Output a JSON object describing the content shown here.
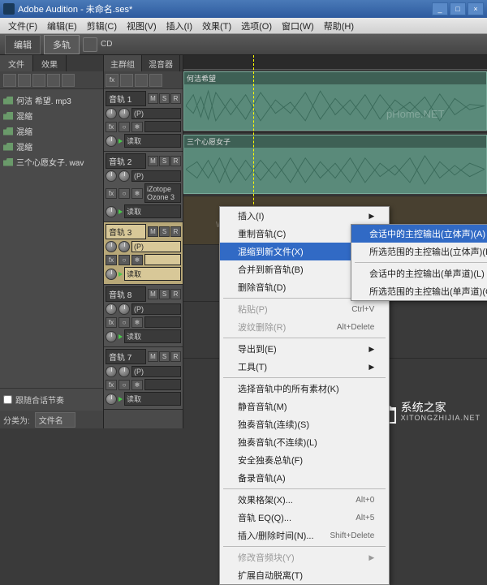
{
  "title": "Adobe Audition - 未命名.ses*",
  "menubar": [
    "文件(F)",
    "编辑(E)",
    "剪辑(C)",
    "视图(V)",
    "插入(I)",
    "效果(T)",
    "选项(O)",
    "窗口(W)",
    "帮助(H)"
  ],
  "toolbar_tabs": {
    "edit": "编辑",
    "multi": "多轨",
    "cd": "CD"
  },
  "left_panel": {
    "tabs": {
      "files": "文件",
      "effects": "效果"
    },
    "files": [
      "何洁 希望. mp3",
      "混缩",
      "混缩",
      "混缩",
      "三个心愿女子. wav"
    ],
    "follow_checkbox": "跟随合话节奏",
    "sort_label": "分类为:",
    "sort_value": "文件名"
  },
  "track_panel": {
    "tabs": {
      "main": "主群组",
      "mixer": "混音器"
    },
    "tracks": [
      {
        "name": "音轨 1",
        "msr": [
          "M",
          "S",
          "R"
        ],
        "sub": "",
        "route": "读取"
      },
      {
        "name": "音轨 2",
        "msr": [
          "M",
          "S",
          "R"
        ],
        "sub": "iZotope Ozone 3",
        "route": "读取"
      },
      {
        "name": "音轨 3",
        "msr": [
          "M",
          "S",
          "R"
        ],
        "sub": "",
        "route": "读取",
        "selected": true
      },
      {
        "name": "音轨 8",
        "msr": [
          "M",
          "S",
          "R"
        ],
        "sub": "",
        "route": "读取"
      },
      {
        "name": "音轨 7",
        "msr": [
          "M",
          "S",
          "R"
        ],
        "sub": "",
        "route": "读取"
      }
    ]
  },
  "wave_clips": [
    {
      "label": "何洁希望"
    },
    {
      "label": "三个心愿女子"
    }
  ],
  "context_menu_main": [
    {
      "label": "插入(I)",
      "arrow": true
    },
    {
      "label": "重制音轨(C)"
    },
    {
      "label": "混缩到新文件(X)",
      "arrow": true,
      "highlight": true
    },
    {
      "label": "合并到新音轨(B)",
      "arrow": true
    },
    {
      "label": "删除音轨(D)"
    },
    {
      "sep": true
    },
    {
      "label": "粘贴(P)",
      "shortcut": "Ctrl+V",
      "disabled": true
    },
    {
      "label": "波纹删除(R)",
      "shortcut": "Alt+Delete",
      "disabled": true
    },
    {
      "sep": true
    },
    {
      "label": "导出到(E)",
      "arrow": true
    },
    {
      "label": "工具(T)",
      "arrow": true
    },
    {
      "sep": true
    },
    {
      "label": "选择音轨中的所有素材(K)"
    },
    {
      "label": "静音音轨(M)"
    },
    {
      "label": "独奏音轨(连续)(S)"
    },
    {
      "label": "独奏音轨(不连续)(L)"
    },
    {
      "label": "安全独奏总轨(F)"
    },
    {
      "label": "备录音轨(A)"
    },
    {
      "sep": true
    },
    {
      "label": "效果格架(X)...",
      "shortcut": "Alt+0"
    },
    {
      "label": "音轨 EQ(Q)...",
      "shortcut": "Alt+5"
    },
    {
      "label": "插入/删除时间(N)...",
      "shortcut": "Shift+Delete"
    },
    {
      "sep": true
    },
    {
      "label": "修改音频块(Y)",
      "arrow": true,
      "disabled": true
    },
    {
      "label": "扩展自动脱离(T)"
    }
  ],
  "context_menu_sub": [
    {
      "label": "会话中的主控输出(立体声)(A)",
      "highlight": true
    },
    {
      "label": "所选范围的主控输出(立体声)(R)"
    },
    {
      "sep": true
    },
    {
      "label": "会话中的主控输出(单声道)(L)"
    },
    {
      "label": "所选范围的主控输出(单声道)(G)"
    }
  ],
  "watermarks": {
    "w1": "www.pHome.NET",
    "w2": "pHome.NET"
  },
  "site_logo": {
    "name": "系统之家",
    "url": "XITONGZHIJIA.NET"
  }
}
